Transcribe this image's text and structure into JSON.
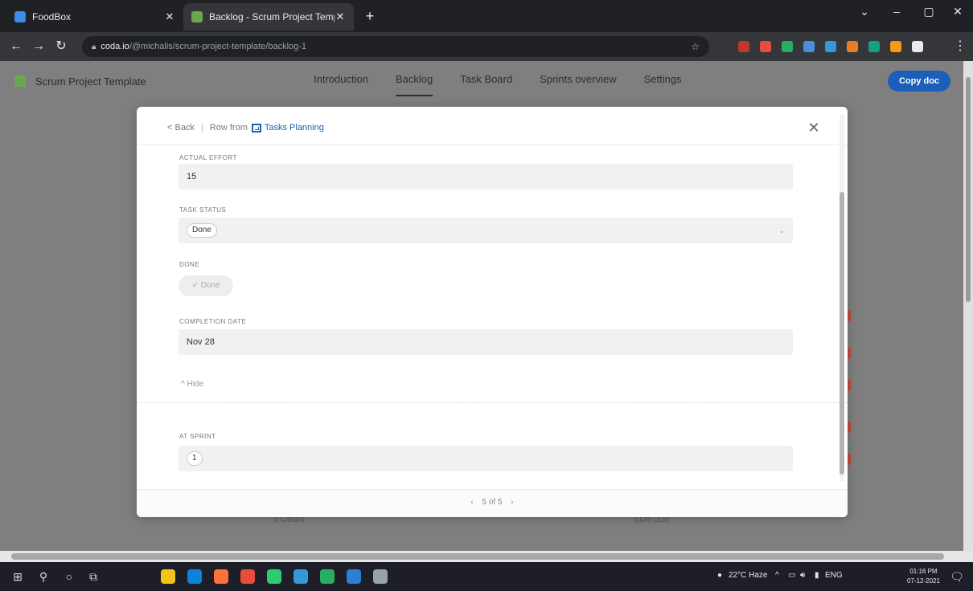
{
  "browser": {
    "tabs": [
      {
        "title": "FoodBox",
        "favicon_color": "#3a8ee6"
      },
      {
        "title": "Backlog - Scrum Project Template",
        "favicon_color": "#6aa84f"
      }
    ],
    "active_tab_index": 1,
    "new_tab_label": "+",
    "window_controls": [
      "⌄",
      "–",
      "▢",
      "✕"
    ],
    "url_host": "coda.io",
    "url_path": "/@michalis/scrum-project-template/backlog-1",
    "extension_colors": [
      "#c0392b",
      "#e74c3c",
      "#27ae60",
      "#4a90d9",
      "#3498db",
      "#e67e22",
      "#16a085",
      "#f39c12",
      "#e8eaed"
    ]
  },
  "doc": {
    "title": "Scrum Project Template",
    "nav_tabs": [
      "Introduction",
      "Backlog",
      "Task Board",
      "Sprints overview",
      "Settings"
    ],
    "active_nav": "Backlog",
    "copy_button": "Copy doc",
    "footer_left": "5 Count",
    "footer_right": "Sum 208"
  },
  "modal": {
    "back_label": "< Back",
    "row_from_label": "Row from",
    "table_name": "Tasks Planning",
    "close_label": "✕",
    "fields": {
      "actual_effort": {
        "label": "ACTUAL EFFORT",
        "value": "15"
      },
      "task_status": {
        "label": "TASK STATUS",
        "value": "Done"
      },
      "done": {
        "label": "DONE",
        "value": "✓ Done"
      },
      "completion_date": {
        "label": "COMPLETION DATE",
        "value": "Nov 28"
      },
      "at_sprint": {
        "label": "AT SPRINT",
        "value": "1"
      }
    },
    "hide_label": "^ Hide",
    "pager": {
      "prev": "‹",
      "text": "5 of 5",
      "next": "›"
    }
  },
  "taskbar": {
    "weather": "22°C Haze",
    "lang": "ENG",
    "time": "01:16 PM",
    "date": "07-12-2021",
    "app_colors": [
      "#f0c419",
      "#0b84d6",
      "#ff7139",
      "#e74c3c",
      "#2ecc71",
      "#3498db",
      "#27ae60",
      "#2d7fd3",
      "#95a5a6"
    ]
  }
}
